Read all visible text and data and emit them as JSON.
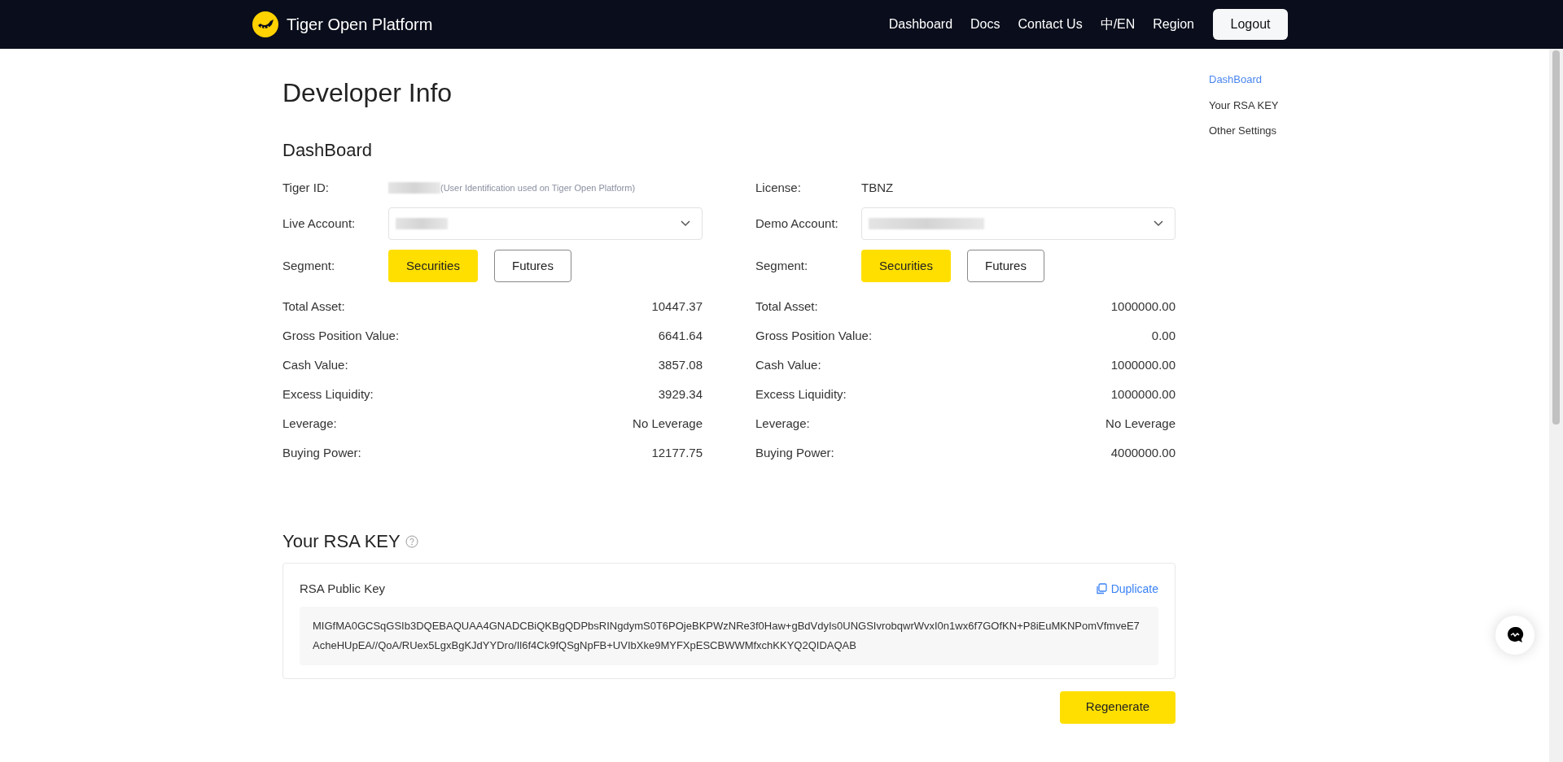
{
  "header": {
    "brand": "Tiger Open Platform",
    "nav": [
      "Dashboard",
      "Docs",
      "Contact Us",
      "中/EN",
      "Region"
    ],
    "logout": "Logout"
  },
  "page_title": "Developer Info",
  "dashboard": {
    "heading": "DashBoard",
    "tiger_id": {
      "label": "Tiger ID:",
      "hint": "(User Identification used on Tiger Open Platform)"
    },
    "license": {
      "label": "License:",
      "value": "TBNZ"
    },
    "accounts": [
      {
        "account_label": "Live Account:",
        "segment_label": "Segment:",
        "segments": [
          {
            "label": "Securities",
            "selected": true
          },
          {
            "label": "Futures",
            "selected": false
          }
        ],
        "metrics": [
          {
            "label": "Total Asset:",
            "value": "10447.37"
          },
          {
            "label": "Gross Position Value:",
            "value": "6641.64"
          },
          {
            "label": "Cash Value:",
            "value": "3857.08"
          },
          {
            "label": "Excess Liquidity:",
            "value": "3929.34"
          },
          {
            "label": "Leverage:",
            "value": "No Leverage"
          },
          {
            "label": "Buying Power:",
            "value": "12177.75"
          }
        ]
      },
      {
        "account_label": "Demo Account:",
        "segment_label": "Segment:",
        "segments": [
          {
            "label": "Securities",
            "selected": true
          },
          {
            "label": "Futures",
            "selected": false
          }
        ],
        "metrics": [
          {
            "label": "Total Asset:",
            "value": "1000000.00"
          },
          {
            "label": "Gross Position Value:",
            "value": "0.00"
          },
          {
            "label": "Cash Value:",
            "value": "1000000.00"
          },
          {
            "label": "Excess Liquidity:",
            "value": "1000000.00"
          },
          {
            "label": "Leverage:",
            "value": "No Leverage"
          },
          {
            "label": "Buying Power:",
            "value": "4000000.00"
          }
        ]
      }
    ]
  },
  "rsa": {
    "heading": "Your RSA KEY",
    "card_title": "RSA Public Key",
    "duplicate": "Duplicate",
    "key": "MIGfMA0GCSqGSIb3DQEBAQUAA4GNADCBiQKBgQDPbsRINgdymS0T6POjeBKPWzNRe3f0Haw+gBdVdyIs0UNGSIvrobqwrWvxI0n1wx6f7GOfKN+P8iEuMKNPomVfmveE7AcheHUpEA//QoA/RUex5LgxBgKJdYYDro/Il6f4Ck9fQSgNpFB+UVIbXke9MYFXpESCBWWMfxchKKYQ2QIDAQAB",
    "regenerate": "Regenerate"
  },
  "toc": [
    {
      "label": "DashBoard",
      "selected": true
    },
    {
      "label": "Your RSA KEY",
      "selected": false
    },
    {
      "label": "Other Settings",
      "selected": false
    }
  ]
}
